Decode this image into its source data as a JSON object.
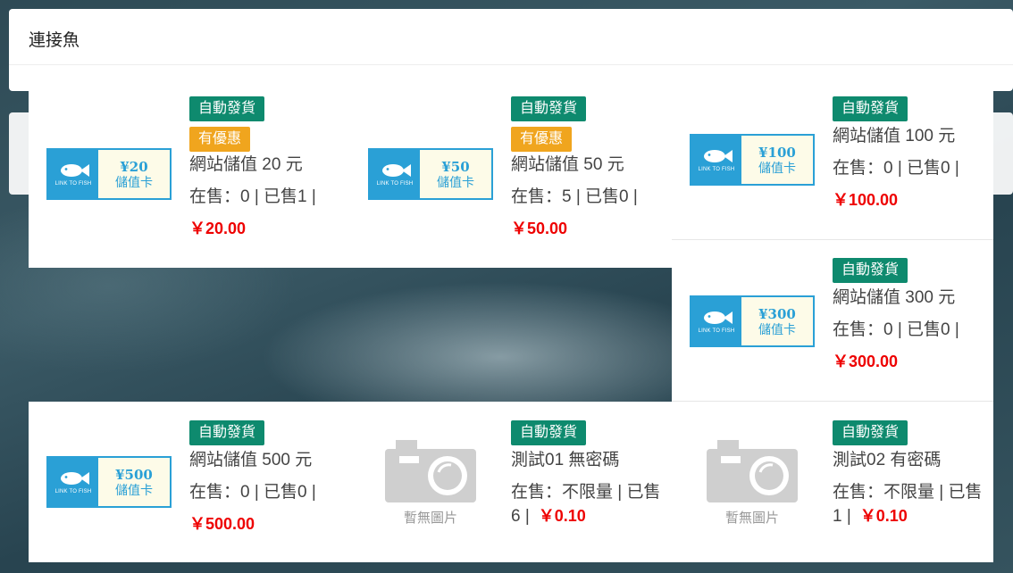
{
  "header": {
    "title": "連接魚"
  },
  "products": [
    {
      "badges": [
        "自動發貨",
        "有優惠"
      ],
      "name": "網站儲值 20 元",
      "stock": "在售：0 | 已售1 |",
      "price": "￥20.00",
      "card": {
        "amount": "¥20",
        "label": "儲值卡",
        "brand": "LINK TO FISH"
      }
    },
    {
      "badges": [
        "自動發貨",
        "有優惠"
      ],
      "name": "網站儲值 50 元",
      "stock": "在售：5 | 已售0 |",
      "price": "￥50.00",
      "card": {
        "amount": "¥50",
        "label": "儲值卡",
        "brand": "LINK TO FISH"
      }
    },
    {
      "badges": [
        "自動發貨"
      ],
      "name": "網站儲值 100 元",
      "stock": "在售：0 | 已售0 |",
      "price": "￥100.00",
      "card": {
        "amount": "¥100",
        "label": "儲值卡",
        "brand": "LINK TO FISH"
      }
    },
    {
      "badges": [
        "自動發貨"
      ],
      "name": "網站儲值 300 元",
      "stock": "在售：0 | 已售0 |",
      "price": "￥300.00",
      "card": {
        "amount": "¥300",
        "label": "儲值卡",
        "brand": "LINK TO FISH"
      }
    },
    {
      "badges": [
        "自動發貨"
      ],
      "name": "網站儲值 500 元",
      "stock": "在售：0 | 已售0 |",
      "price": "￥500.00",
      "card": {
        "amount": "¥500",
        "label": "儲值卡",
        "brand": "LINK TO FISH"
      }
    },
    {
      "badges": [
        "自動發貨"
      ],
      "name": "測試01 無密碼",
      "stock": "在售：不限量 | 已售6 |",
      "price": "￥0.10",
      "no_image": "暫無圖片"
    },
    {
      "badges": [
        "自動發貨"
      ],
      "name": "測試02 有密碼",
      "stock": "在售：不限量 | 已售1 |",
      "price": "￥0.10",
      "no_image": "暫無圖片"
    }
  ],
  "colors": {
    "badge_green": "#0e8a6e",
    "badge_orange": "#f0a51e",
    "price_red": "#e00000",
    "card_blue": "#2aa0d6"
  },
  "icons": {
    "card": "fish-icon",
    "placeholder": "camera-icon"
  }
}
